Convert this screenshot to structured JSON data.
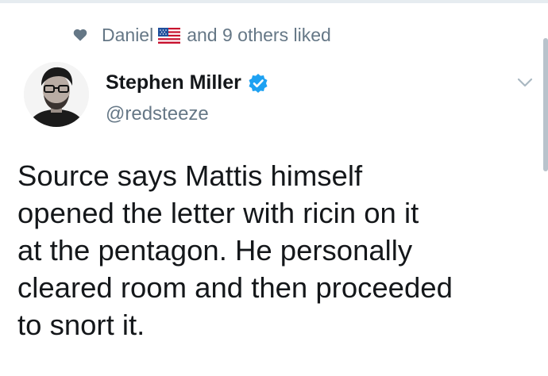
{
  "social_context": {
    "liker_name": "Daniel",
    "liker_flag": "us-flag-icon",
    "others_text": "and 9 others liked"
  },
  "author": {
    "display_name": "Stephen Miller",
    "handle": "@redsteeze",
    "verified": true
  },
  "tweet": {
    "lines": [
      "Source says Mattis himself",
      "opened the letter with ricin on it",
      "at the pentagon. He personally",
      "cleared room and then proceeded",
      "to snort it."
    ]
  },
  "colors": {
    "text_primary": "#14171a",
    "text_secondary": "#657786",
    "verified_blue": "#1da1f2"
  }
}
